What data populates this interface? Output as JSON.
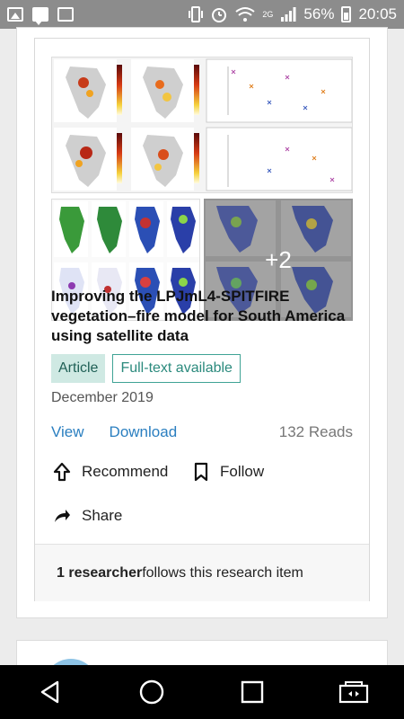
{
  "status_bar": {
    "network": "2G",
    "battery": "56%",
    "time": "20:05"
  },
  "item": {
    "more_figures": "+2",
    "title": "Improving the LPJmL4-SPITFIRE vegetation–fire model for South America using satellite data",
    "badges": {
      "article": "Article",
      "fulltext": "Full-text available"
    },
    "date": "December 2019",
    "actions": {
      "view": "View",
      "download": "Download",
      "reads": "132 Reads",
      "recommend": "Recommend",
      "follow": "Follow",
      "share": "Share"
    },
    "followers": {
      "count": "1 researcher",
      "text": " follows this research item"
    }
  },
  "colors": {
    "accent": "#2b7fc0",
    "badge_bg": "#cfe9e3",
    "badge_border": "#3fa395"
  }
}
